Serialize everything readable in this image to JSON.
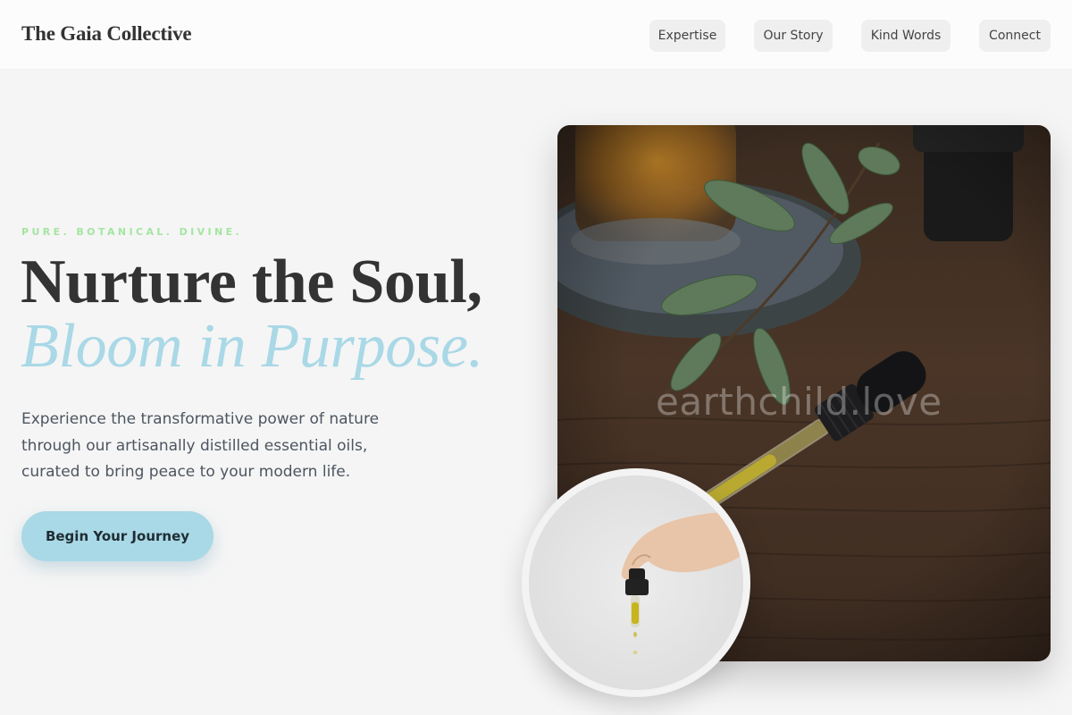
{
  "header": {
    "brand": "The Gaia Collective",
    "nav": [
      {
        "label": "Expertise"
      },
      {
        "label": "Our Story"
      },
      {
        "label": "Kind Words"
      },
      {
        "label": "Connect"
      }
    ]
  },
  "hero": {
    "eyebrow": "PURE. BOTANICAL. DIVINE.",
    "title_line1": "Nurture the Soul,",
    "title_line2": "Bloom in Purpose.",
    "lead": "Experience the transformative power of nature through our artisanally distilled essential oils, curated to bring peace to your modern life.",
    "cta_label": "Begin Your Journey"
  },
  "media": {
    "main_photo_watermark": "earthchild.love",
    "main_photo_icon": "essential-oil-dropper-photo",
    "inset_photo_icon": "hand-dropper-photo"
  },
  "colors": {
    "accent": "#a9d8e6",
    "eyebrow": "#a4e5a0",
    "text": "#333333",
    "background": "#f5f5f5"
  }
}
